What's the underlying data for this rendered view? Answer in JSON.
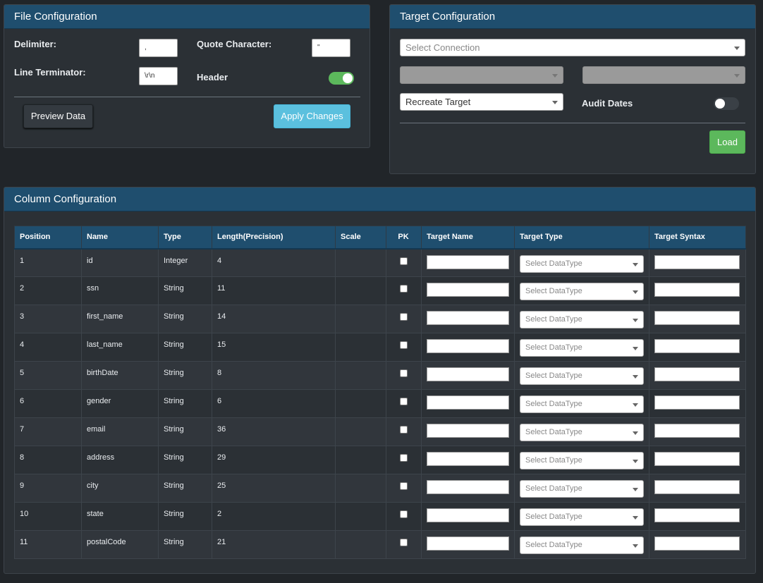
{
  "file_config": {
    "title": "File Configuration",
    "delimiter_label": "Delimiter:",
    "delimiter_value": ",",
    "quote_label": "Quote Character:",
    "quote_value": "\"",
    "line_terminator_label": "Line Terminator:",
    "line_terminator_value": "\\r\\n",
    "header_label": "Header",
    "header_on": true,
    "preview_button": "Preview Data",
    "apply_button": "Apply Changes"
  },
  "target_config": {
    "title": "Target Configuration",
    "connection_placeholder": "Select Connection",
    "mode_value": "Recreate Target",
    "audit_label": "Audit Dates",
    "audit_on": false,
    "load_button": "Load"
  },
  "column_config": {
    "title": "Column Configuration",
    "headers": [
      "Position",
      "Name",
      "Type",
      "Length(Precision)",
      "Scale",
      "PK",
      "Target Name",
      "Target Type",
      "Target Syntax"
    ],
    "datatype_placeholder": "Select DataType",
    "rows": [
      {
        "position": "1",
        "name": "id",
        "type": "Integer",
        "length": "4",
        "scale": ""
      },
      {
        "position": "2",
        "name": "ssn",
        "type": "String",
        "length": "11",
        "scale": ""
      },
      {
        "position": "3",
        "name": "first_name",
        "type": "String",
        "length": "14",
        "scale": ""
      },
      {
        "position": "4",
        "name": "last_name",
        "type": "String",
        "length": "15",
        "scale": ""
      },
      {
        "position": "5",
        "name": "birthDate",
        "type": "String",
        "length": "8",
        "scale": ""
      },
      {
        "position": "6",
        "name": "gender",
        "type": "String",
        "length": "6",
        "scale": ""
      },
      {
        "position": "7",
        "name": "email",
        "type": "String",
        "length": "36",
        "scale": ""
      },
      {
        "position": "8",
        "name": "address",
        "type": "String",
        "length": "29",
        "scale": ""
      },
      {
        "position": "9",
        "name": "city",
        "type": "String",
        "length": "25",
        "scale": ""
      },
      {
        "position": "10",
        "name": "state",
        "type": "String",
        "length": "2",
        "scale": ""
      },
      {
        "position": "11",
        "name": "postalCode",
        "type": "String",
        "length": "21",
        "scale": ""
      }
    ]
  },
  "colors": {
    "header_bg": "#1f4e6e",
    "panel_bg": "#2b3035",
    "page_bg": "#212529",
    "toggle_on": "#5cb85c",
    "apply_button": "#5bc0de",
    "load_button": "#5cb85c"
  }
}
